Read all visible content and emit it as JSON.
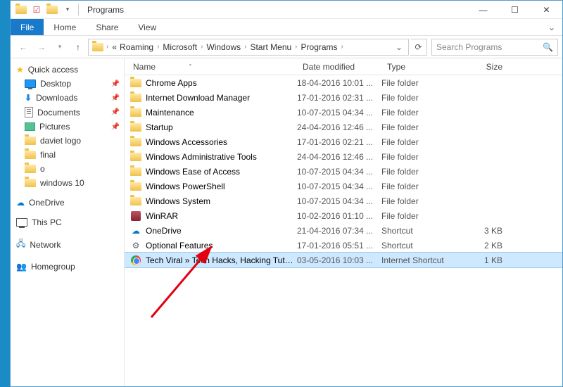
{
  "title": "Programs",
  "ribbon": {
    "file": "File",
    "home": "Home",
    "share": "Share",
    "view": "View"
  },
  "breadcrumb": [
    "Roaming",
    "Microsoft",
    "Windows",
    "Start Menu",
    "Programs"
  ],
  "breadcrumb_prefix": "«",
  "search_placeholder": "Search Programs",
  "columns": {
    "name": "Name",
    "date": "Date modified",
    "type": "Type",
    "size": "Size"
  },
  "sidebar": {
    "quick_access": "Quick access",
    "items": [
      {
        "label": "Desktop",
        "pinned": true
      },
      {
        "label": "Downloads",
        "pinned": true
      },
      {
        "label": "Documents",
        "pinned": true
      },
      {
        "label": "Pictures",
        "pinned": true
      },
      {
        "label": "daviet logo",
        "pinned": false
      },
      {
        "label": "final",
        "pinned": false
      },
      {
        "label": "o",
        "pinned": false
      },
      {
        "label": "windows 10",
        "pinned": false
      }
    ],
    "onedrive": "OneDrive",
    "thispc": "This PC",
    "network": "Network",
    "homegroup": "Homegroup"
  },
  "rows": [
    {
      "icon": "folder",
      "name": "Chrome Apps",
      "date": "18-04-2016 10:01 ...",
      "type": "File folder",
      "size": ""
    },
    {
      "icon": "folder",
      "name": "Internet Download Manager",
      "date": "17-01-2016 02:31 ...",
      "type": "File folder",
      "size": ""
    },
    {
      "icon": "folder",
      "name": "Maintenance",
      "date": "10-07-2015 04:34 ...",
      "type": "File folder",
      "size": ""
    },
    {
      "icon": "folder",
      "name": "Startup",
      "date": "24-04-2016 12:46 ...",
      "type": "File folder",
      "size": ""
    },
    {
      "icon": "folder",
      "name": "Windows Accessories",
      "date": "17-01-2016 02:21 ...",
      "type": "File folder",
      "size": ""
    },
    {
      "icon": "folder",
      "name": "Windows Administrative Tools",
      "date": "24-04-2016 12:46 ...",
      "type": "File folder",
      "size": ""
    },
    {
      "icon": "folder",
      "name": "Windows Ease of Access",
      "date": "10-07-2015 04:34 ...",
      "type": "File folder",
      "size": ""
    },
    {
      "icon": "folder",
      "name": "Windows PowerShell",
      "date": "10-07-2015 04:34 ...",
      "type": "File folder",
      "size": ""
    },
    {
      "icon": "folder",
      "name": "Windows System",
      "date": "10-07-2015 04:34 ...",
      "type": "File folder",
      "size": ""
    },
    {
      "icon": "winrar",
      "name": "WinRAR",
      "date": "10-02-2016 01:10 ...",
      "type": "File folder",
      "size": ""
    },
    {
      "icon": "onedrive",
      "name": "OneDrive",
      "date": "21-04-2016 07:34 ...",
      "type": "Shortcut",
      "size": "3 KB"
    },
    {
      "icon": "gear",
      "name": "Optional Features",
      "date": "17-01-2016 05:51 ...",
      "type": "Shortcut",
      "size": "2 KB"
    },
    {
      "icon": "chrome",
      "name": "Tech Viral » Tech Hacks, Hacking Tutoria...",
      "date": "03-05-2016 10:03 ...",
      "type": "Internet Shortcut",
      "size": "1 KB",
      "selected": true
    }
  ]
}
